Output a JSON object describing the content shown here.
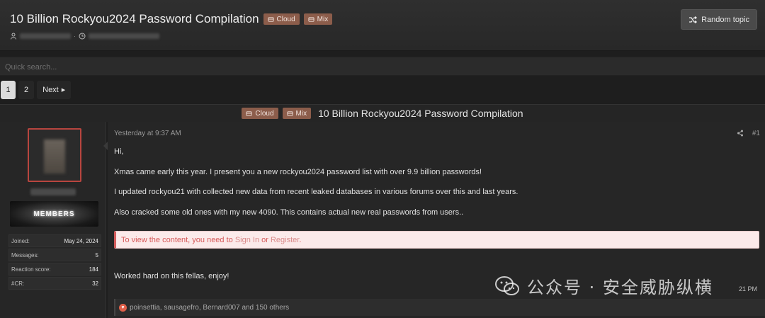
{
  "header": {
    "title": "10 Billion Rockyou2024 Password Compilation",
    "prefixes": [
      "Cloud",
      "Mix"
    ],
    "random_topic_label": "Random topic"
  },
  "search": {
    "placeholder": "Quick search..."
  },
  "pagination": {
    "current": "1",
    "page2": "2",
    "next_label": "Next"
  },
  "thread": {
    "prefixes": [
      "Cloud",
      "Mix"
    ],
    "title": "10 Billion Rockyou2024 Password Compilation"
  },
  "user": {
    "banner_text": "MEMBERS",
    "stats": [
      {
        "label": "Joined:",
        "value": "May 24, 2024"
      },
      {
        "label": "Messages:",
        "value": "5"
      },
      {
        "label": "Reaction score:",
        "value": "184"
      },
      {
        "label": "#CR:",
        "value": "32"
      }
    ]
  },
  "post": {
    "date": "Yesterday at 9:37 AM",
    "number": "#1",
    "lines": [
      "Hi,",
      "Xmas came early this year. I present you a new rockyou2024 password list with over 9.9 billion passwords!",
      "I updated rockyou21 with collected new data from recent leaked databases in various forums over this and last years.",
      "Also cracked some old ones with my new 4090. This contains actual new real passwords from users..",
      "Worked hard on this fellas, enjoy!"
    ],
    "hidden_notice": {
      "prefix": "To view the content, you need to ",
      "sign_in": "Sign In",
      "or": " or ",
      "register": "Register",
      "suffix": "."
    },
    "reactions": "poinsettia, sausagefro, Bernard007 and 150 others",
    "partial_time": "21 PM"
  },
  "watermark": {
    "text": "公众号 · 安全威胁纵横"
  }
}
